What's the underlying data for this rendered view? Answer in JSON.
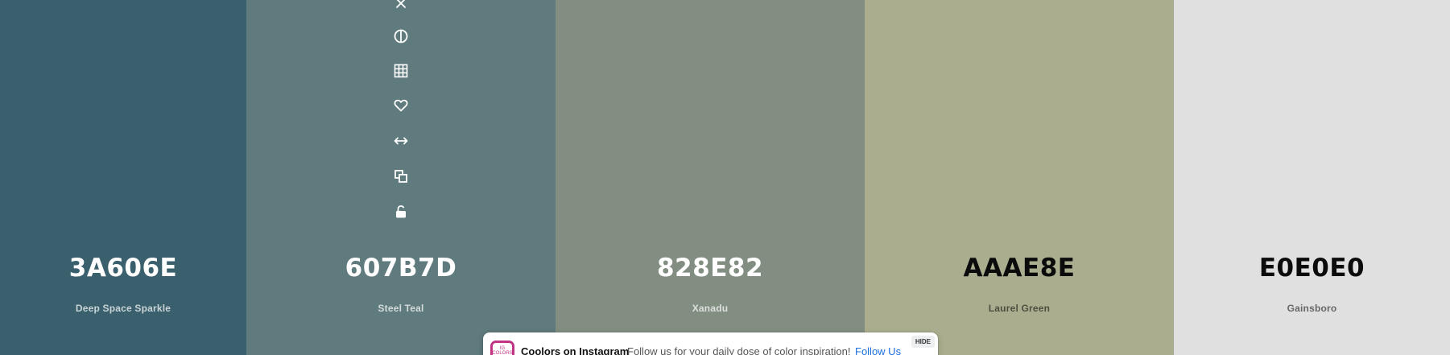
{
  "palette": {
    "colors": [
      {
        "hex": "3A606E",
        "name": "Deep Space Sparkle",
        "color": "#3A606E",
        "text_theme": "light"
      },
      {
        "hex": "607B7D",
        "name": "Steel Teal",
        "color": "#607B7D",
        "text_theme": "light"
      },
      {
        "hex": "828E82",
        "name": "Xanadu",
        "color": "#828E82",
        "text_theme": "light"
      },
      {
        "hex": "AAAE8E",
        "name": "Laurel Green",
        "color": "#AAAE8E",
        "text_theme": "dark"
      },
      {
        "hex": "E0E0E0",
        "name": "Gainsboro",
        "color": "#E0E0E0",
        "text_theme": "dark"
      }
    ]
  },
  "toolbar": {
    "icons": [
      "close-icon",
      "contrast-icon",
      "grid-shades-icon",
      "heart-icon",
      "drag-arrows-icon",
      "copy-icon",
      "unlock-icon"
    ]
  },
  "banner": {
    "logo_text": "IG\nCOLORS",
    "title": "Coolors on Instagram",
    "text": "Follow us for your daily dose of color inspiration!",
    "link": "Follow Us",
    "hide": "HIDE"
  }
}
